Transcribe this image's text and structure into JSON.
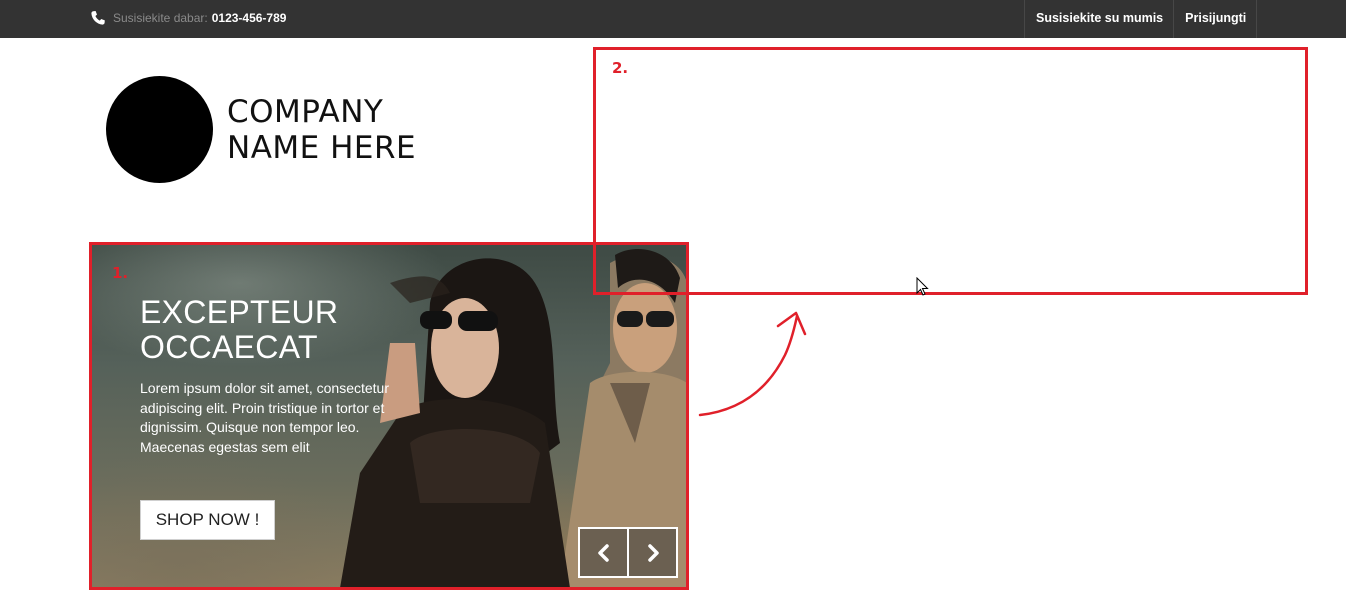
{
  "topbar": {
    "contact_label": "Susisiekite dabar:",
    "phone": "0123-456-789",
    "links": [
      {
        "label": "Susisiekite su mumis"
      },
      {
        "label": "Prisijungti"
      }
    ],
    "icon": "phone-icon"
  },
  "logo": {
    "line1": "COMPANY",
    "line2": "NAME HERE"
  },
  "slider": {
    "title_line1": "EXCEPTEUR",
    "title_line2": "OCCAECAT",
    "body": "Lorem ipsum dolor sit amet, consectetur adipiscing elit. Proin tristique in tortor et dignissim. Quisque non tempor leo. Maecenas egestas sem elit",
    "cta": "SHOP NOW !",
    "prev_icon": "chevron-left-icon",
    "next_icon": "chevron-right-icon"
  },
  "annotations": {
    "box1_label": "1.",
    "box2_label": "2.",
    "color": "#e0202a"
  },
  "colors": {
    "topbar": "#333333",
    "background": "#ffffff"
  }
}
